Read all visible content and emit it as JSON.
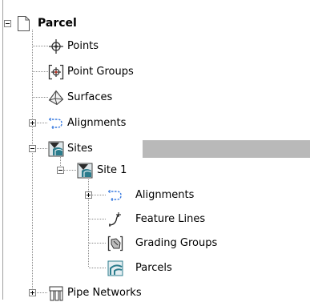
{
  "tree": {
    "root_label": "Parcel",
    "points_label": "Points",
    "point_groups_label": "Point Groups",
    "surfaces_label": "Surfaces",
    "alignments_label": "Alignments",
    "sites_label": "Sites",
    "site1_label": "Site 1",
    "site_alignments_label": "Alignments",
    "feature_lines_label": "Feature Lines",
    "grading_groups_label": "Grading Groups",
    "parcels_label": "Parcels",
    "pipe_networks_label": "Pipe Networks"
  },
  "colors": {
    "selection": "#b9b9b9",
    "alignment_blue": "#3a7be0",
    "site_teal": "#2b7c8c"
  },
  "icons": {
    "root": "parcel-document-icon",
    "points": "point-icon",
    "point_groups": "point-group-icon",
    "surfaces": "surface-icon",
    "alignments": "alignment-icon",
    "sites": "site-icon",
    "feature_lines": "feature-line-icon",
    "grading_groups": "grading-group-icon",
    "parcels": "parcel-icon",
    "pipe_networks": "pipe-network-icon"
  }
}
